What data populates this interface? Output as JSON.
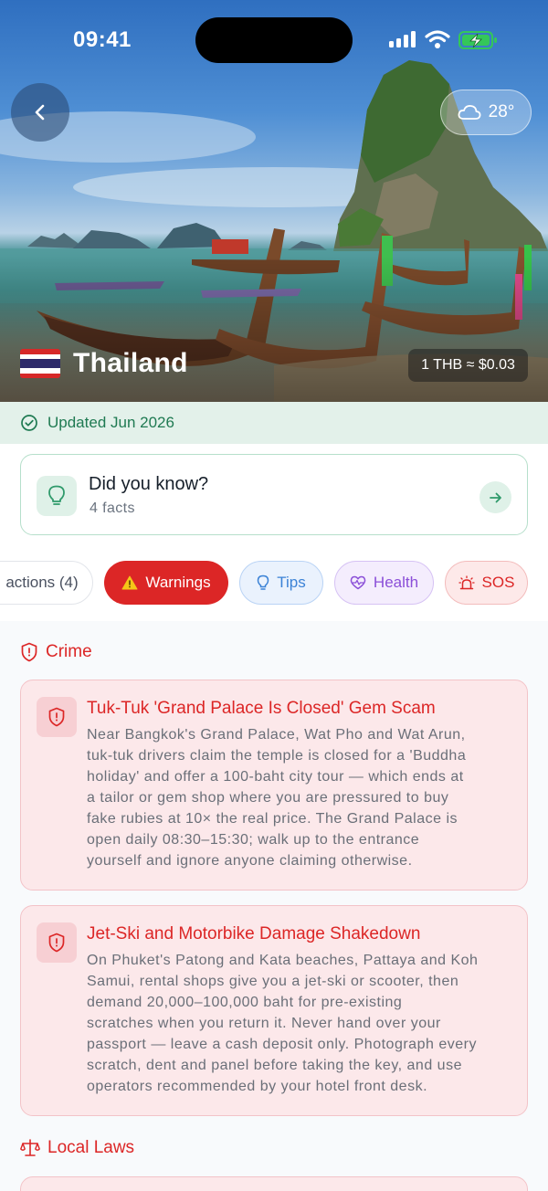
{
  "status": {
    "time": "09:41"
  },
  "hero": {
    "weather": "28°",
    "country_name": "Thailand",
    "exchange_rate": "1 THB ≈ $0.03"
  },
  "updated": {
    "label": "Updated Jun 2026"
  },
  "did_you_know": {
    "title": "Did you know?",
    "subtitle": "4 facts"
  },
  "chips": [
    {
      "label": "actions (4)"
    },
    {
      "label": "Warnings"
    },
    {
      "label": "Tips"
    },
    {
      "label": "Health"
    },
    {
      "label": "SOS"
    }
  ],
  "sections": {
    "crime": {
      "title": "Crime",
      "cards": [
        {
          "title": "Tuk-Tuk 'Grand Palace Is Closed' Gem Scam",
          "lines": [
            "Near Bangkok's Grand Palace, Wat Pho and Wat Arun,",
            "tuk-tuk drivers claim the temple is closed for a 'Buddha",
            "holiday' and offer a 100-baht city tour — which ends at",
            "a tailor or gem shop where you are pressured to buy",
            "fake rubies at 10× the real price. The Grand Palace is",
            "open daily 08:30–15:30; walk up to the entrance",
            "yourself and ignore anyone claiming otherwise."
          ]
        },
        {
          "title": "Jet-Ski and Motorbike Damage Shakedown",
          "lines": [
            "On Phuket's Patong and Kata beaches, Pattaya and Koh",
            "Samui, rental shops give you a jet-ski or scooter, then",
            "demand 20,000–100,000 baht for pre-existing",
            "scratches when you return it. Never hand over your",
            "passport — leave a cash deposit only. Photograph every",
            "scratch, dent and panel before taking the key, and use",
            "operators recommended by your hotel front desk."
          ]
        }
      ]
    },
    "local_laws": {
      "title": "Local Laws"
    }
  },
  "colors": {
    "accent_red": "#dc2626",
    "accent_green": "#1f7a52",
    "tips_blue": "#3b82d6",
    "health_purple": "#8b4fd8"
  }
}
